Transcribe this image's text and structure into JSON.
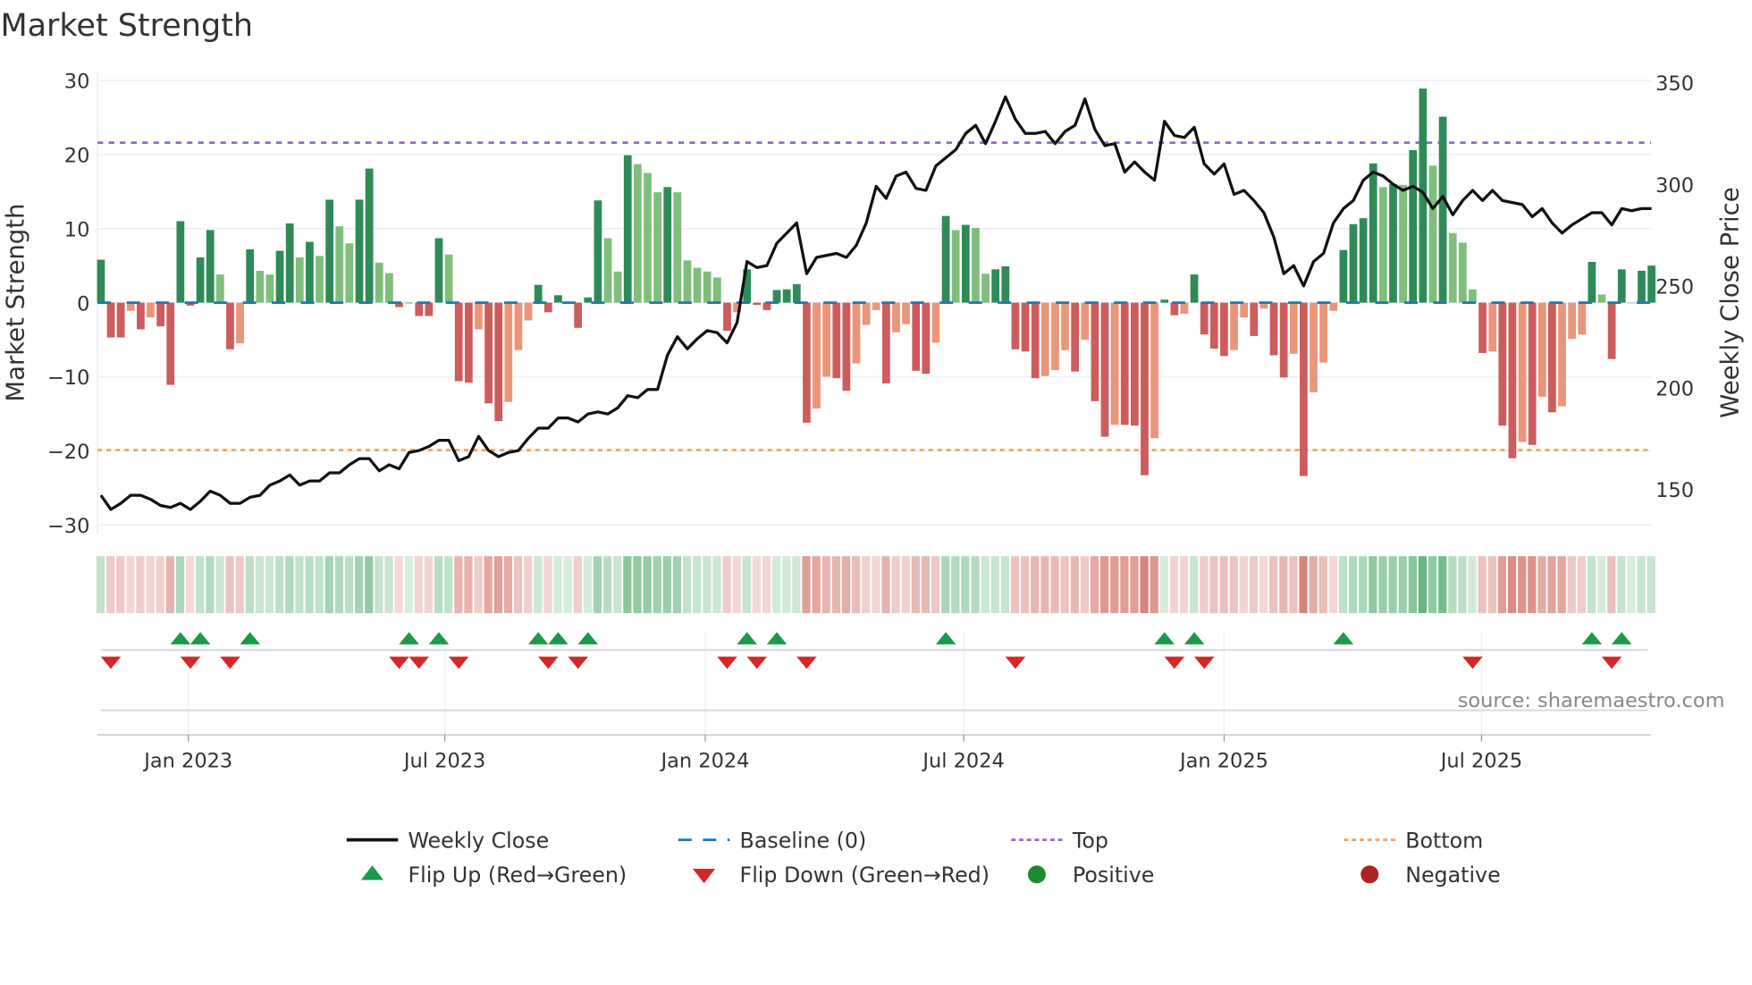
{
  "chart_data": {
    "type": "bar",
    "title": "Market Strength",
    "ylabel": "Market Strength",
    "y2label": "Weekly Close Price",
    "ylim": [
      -30,
      30
    ],
    "y2lim": [
      150,
      350
    ],
    "yticks": [
      30,
      20,
      10,
      0,
      -10,
      -20,
      -30
    ],
    "y2ticks": [
      350,
      300,
      250,
      200,
      150
    ],
    "x_ticks": [
      {
        "label": "Jan 2023",
        "week": 8.8
      },
      {
        "label": "Jul 2023",
        "week": 34.6
      },
      {
        "label": "Jan 2024",
        "week": 60.8
      },
      {
        "label": "Jul 2024",
        "week": 86.8
      },
      {
        "label": "Jan 2025",
        "week": 113.0
      },
      {
        "label": "Jul 2025",
        "week": 138.9
      }
    ],
    "top_level": 21.6,
    "bottom_level": -19.9,
    "baseline": 0,
    "strength": [
      5.8,
      -4.7,
      -4.7,
      -1.1,
      -3.6,
      -2.0,
      -3.2,
      -11.1,
      11.0,
      -0.4,
      6.1,
      9.8,
      3.8,
      -6.3,
      -5.5,
      7.2,
      4.3,
      3.8,
      7.0,
      10.7,
      6.1,
      8.2,
      6.3,
      13.9,
      10.3,
      8.0,
      13.9,
      18.1,
      5.4,
      4.0,
      -0.6,
      0,
      -1.8,
      -1.8,
      8.7,
      6.5,
      -10.6,
      -10.8,
      -3.6,
      -13.6,
      -16.0,
      -13.4,
      -6.4,
      -2.4,
      2.4,
      -1.3,
      1.0,
      0,
      -3.4,
      0.7,
      13.8,
      8.7,
      4.2,
      19.9,
      18.7,
      17.5,
      14.9,
      15.6,
      14.9,
      5.7,
      4.7,
      4.2,
      3.4,
      -3.8,
      -1.3,
      4.5,
      -0.3,
      -1.0,
      1.7,
      1.8,
      2.5,
      -16.2,
      -14.3,
      -10.0,
      -10.2,
      -11.9,
      -8.2,
      -3.0,
      -1.0,
      -10.9,
      -4.0,
      -2.9,
      -9.2,
      -9.6,
      -5.4,
      11.7,
      9.8,
      10.5,
      10.1,
      3.9,
      4.5,
      4.9,
      -6.3,
      -6.6,
      -10.2,
      -9.9,
      -9.1,
      -6.4,
      -9.3,
      -5.0,
      -13.3,
      -18.1,
      -16.5,
      -16.5,
      -16.6,
      -23.3,
      -18.3,
      0.4,
      -1.7,
      -1.5,
      3.8,
      -4.3,
      -6.2,
      -7.2,
      -6.4,
      -2.0,
      -4.5,
      -0.8,
      -7.1,
      -10.1,
      -6.9,
      -23.4,
      -12.1,
      -8.1,
      -1.1,
      7.1,
      10.6,
      11.4,
      18.8,
      15.6,
      16.0,
      15.9,
      20.6,
      28.9,
      18.5,
      25.1,
      9.4,
      8.1,
      1.8,
      -6.8,
      -6.6,
      -16.6,
      -21.0,
      -18.8,
      -19.2,
      -12.7,
      -14.8,
      -14.0,
      -4.9,
      -4.3,
      5.5,
      1.1,
      -7.6,
      4.5,
      0,
      4.3,
      5.0
    ],
    "close": [
      147,
      140,
      143,
      147,
      147,
      145,
      142,
      141,
      143,
      140,
      144,
      149,
      147,
      143,
      143,
      146,
      147,
      152,
      154,
      157,
      152,
      154,
      154,
      158,
      158,
      162,
      165,
      165,
      159,
      162,
      160,
      168,
      169,
      171,
      174,
      174,
      164,
      166,
      176,
      169,
      166,
      168,
      169,
      175,
      180,
      180,
      185,
      185,
      183,
      187,
      188,
      187,
      190,
      196,
      195,
      199,
      199,
      216,
      225,
      219,
      224,
      228,
      227,
      222,
      232,
      262,
      259,
      260,
      271,
      276,
      281,
      256,
      264,
      265,
      266,
      264,
      270,
      281,
      299,
      293,
      304,
      306,
      298,
      297,
      309,
      313,
      317,
      325,
      329,
      320,
      331,
      343,
      332,
      325,
      325,
      326,
      320,
      326,
      329,
      342,
      327,
      319,
      320,
      306,
      311,
      306,
      302,
      331,
      324,
      323,
      328,
      310,
      305,
      310,
      295,
      297,
      292,
      286,
      274,
      256,
      260,
      250,
      262,
      266,
      281,
      288,
      292,
      302,
      306,
      304,
      300,
      297,
      299,
      296,
      288,
      294,
      285,
      292,
      297,
      292,
      297,
      292,
      291,
      290,
      284,
      288,
      281,
      276,
      280,
      283,
      286,
      286,
      280,
      288,
      287,
      288,
      288
    ],
    "flip_up_weeks": [
      8,
      10,
      15,
      31,
      34,
      44,
      46,
      49,
      65,
      68,
      85,
      107,
      110,
      125,
      150,
      153
    ],
    "flip_down_weeks": [
      1,
      9,
      13,
      30,
      32,
      36,
      45,
      48,
      63,
      66,
      71,
      92,
      108,
      111,
      138,
      152
    ],
    "colors": {
      "pos_strong": "#2e8b57",
      "pos_weak": "#7fbf7b",
      "neg_strong": "#cd5c5c",
      "neg_weak": "#e9967a",
      "close": "#111111",
      "baseline": "#1f77b4",
      "top": "#9467d6",
      "bottom": "#f4a261",
      "flip_up": "#1a9a4a",
      "flip_down": "#d62728",
      "positive": "#1e8c2e",
      "negative": "#b22222",
      "strip_pos": "#2e9b4f",
      "strip_neg": "#c0392b"
    },
    "legend": [
      {
        "label": "Weekly Close",
        "kind": "line"
      },
      {
        "label": "Baseline (0)",
        "kind": "dash"
      },
      {
        "label": "Top",
        "kind": "dot-top"
      },
      {
        "label": "Bottom",
        "kind": "dot-bottom"
      },
      {
        "label": "Flip Up (Red→Green)",
        "kind": "tri-up"
      },
      {
        "label": "Flip Down (Green→Red)",
        "kind": "tri-down"
      },
      {
        "label": "Positive",
        "kind": "circle-pos"
      },
      {
        "label": "Negative",
        "kind": "circle-neg"
      }
    ],
    "legend_placement": "bottom",
    "source": "source: sharemaestro.com"
  }
}
